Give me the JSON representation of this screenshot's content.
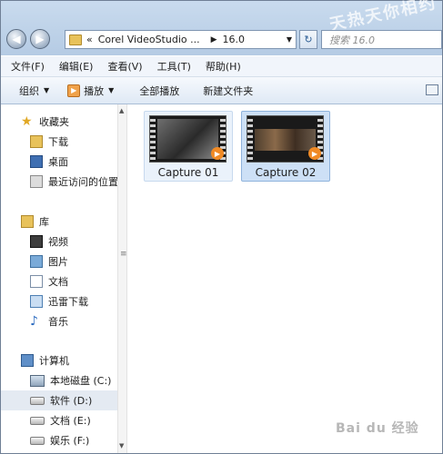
{
  "window": {
    "breadcrumb": [
      "«",
      "Corel VideoStudio ...",
      "16.0"
    ],
    "search_placeholder": "搜索 16.0"
  },
  "menu": [
    "文件(F)",
    "编辑(E)",
    "查看(V)",
    "工具(T)",
    "帮助(H)"
  ],
  "toolbar": {
    "organize": "组织",
    "play": "播放",
    "play_all": "全部播放",
    "new_folder": "新建文件夹"
  },
  "sidebar": {
    "favorites": {
      "title": "收藏夹",
      "items": [
        "下载",
        "桌面",
        "最近访问的位置"
      ]
    },
    "libraries": {
      "title": "库",
      "items": [
        "视频",
        "图片",
        "文档",
        "迅雷下载",
        "音乐"
      ]
    },
    "computer": {
      "title": "计算机",
      "items": [
        "本地磁盘 (C:)",
        "软件 (D:)",
        "文档 (E:)",
        "娱乐 (F:)"
      ]
    }
  },
  "files": [
    {
      "name": "Capture 01",
      "selected": false
    },
    {
      "name": "Capture 02",
      "selected": true
    }
  ],
  "watermarks": {
    "top": "天热天你相约",
    "bottom": "Bai du 经验"
  }
}
